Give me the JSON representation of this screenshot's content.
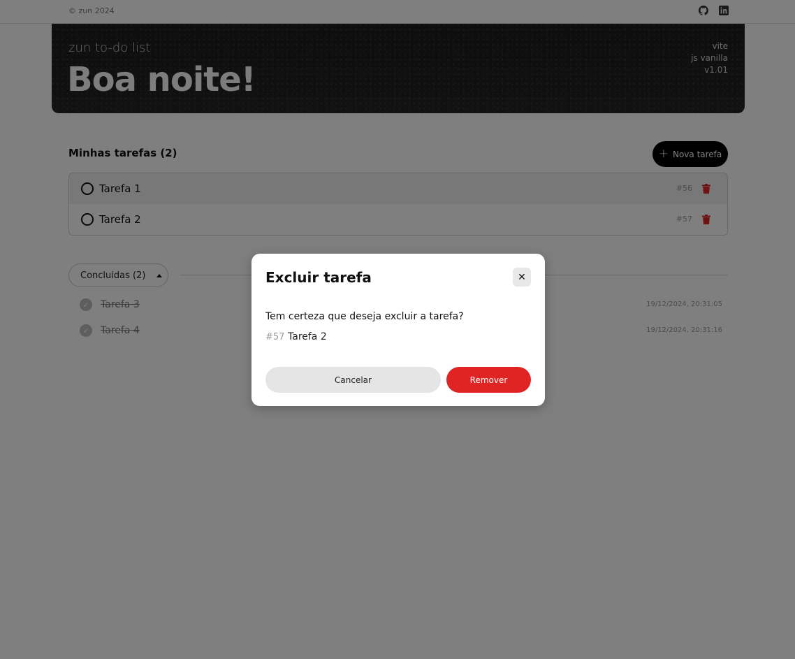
{
  "topbar": {
    "copyright": "© zun 2024",
    "github_icon": "github-icon",
    "linkedin_icon": "linkedin-icon"
  },
  "hero": {
    "subtitle": "zun to-do list",
    "greeting": "Boa noite!",
    "meta": [
      "vite",
      "js vanilla",
      "v1.01"
    ]
  },
  "tasks": {
    "title": "Minhas tarefas (2)",
    "new_button": "Nova tarefa",
    "items": [
      {
        "name": "Tarefa 1",
        "id": "#56"
      },
      {
        "name": "Tarefa 2",
        "id": "#57"
      }
    ]
  },
  "completed": {
    "label": "Concluidas (2)",
    "items": [
      {
        "name": "Tarefa 3",
        "time": "19/12/2024, 20:31:05"
      },
      {
        "name": "Tarefa 4",
        "time": "19/12/2024, 20:31:16"
      }
    ]
  },
  "modal": {
    "title": "Excluir tarefa",
    "close_icon": "close-icon",
    "question": "Tem certeza que deseja excluir a tarefa?",
    "task_id": "#57",
    "task_name": "Tarefa 2",
    "cancel": "Cancelar",
    "remove": "Remover"
  },
  "colors": {
    "danger": "#e02424",
    "primary": "#000000",
    "overlay": "rgba(0,0,0,0.5)"
  }
}
